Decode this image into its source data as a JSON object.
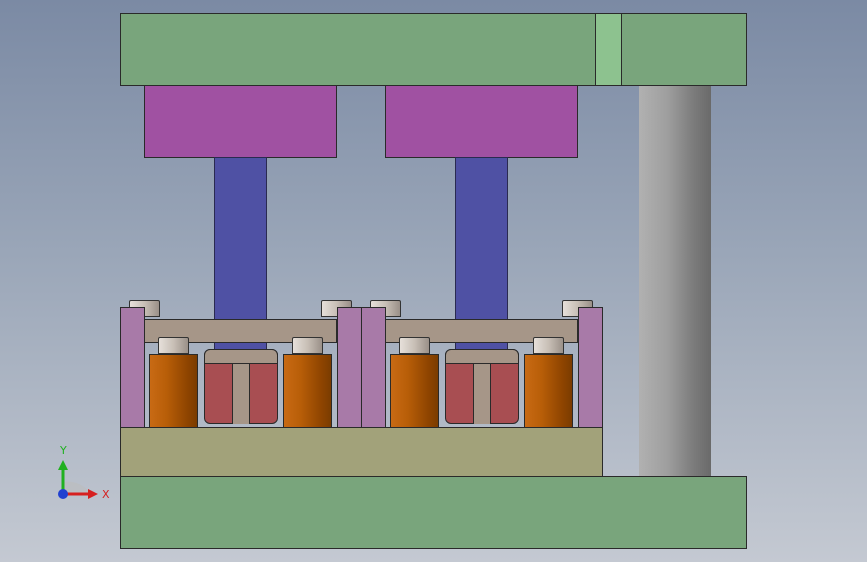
{
  "viewport": {
    "background_top": "#7b8aa4",
    "background_bottom": "#c4c9d2"
  },
  "model": {
    "top_plate_color": "#79a57c",
    "bottom_plate_color": "#79a57c",
    "guide_slot_color": "#8dc28f",
    "guide_pillar_color": "#9e9e9e",
    "punch_holder_color": "#a051a2",
    "punch_color": "#4f51a4",
    "die_base_color": "#a2a27a",
    "side_post_color": "#a87aa8",
    "stripper_color": "#a69688",
    "roller_color": "#b85e08",
    "die_block_color": "#a84e52",
    "station_count": 2
  },
  "triad": {
    "x_label": "X",
    "y_label": "Y",
    "x_color": "#d62020",
    "y_color": "#20b020",
    "z_color": "#2040d0"
  }
}
